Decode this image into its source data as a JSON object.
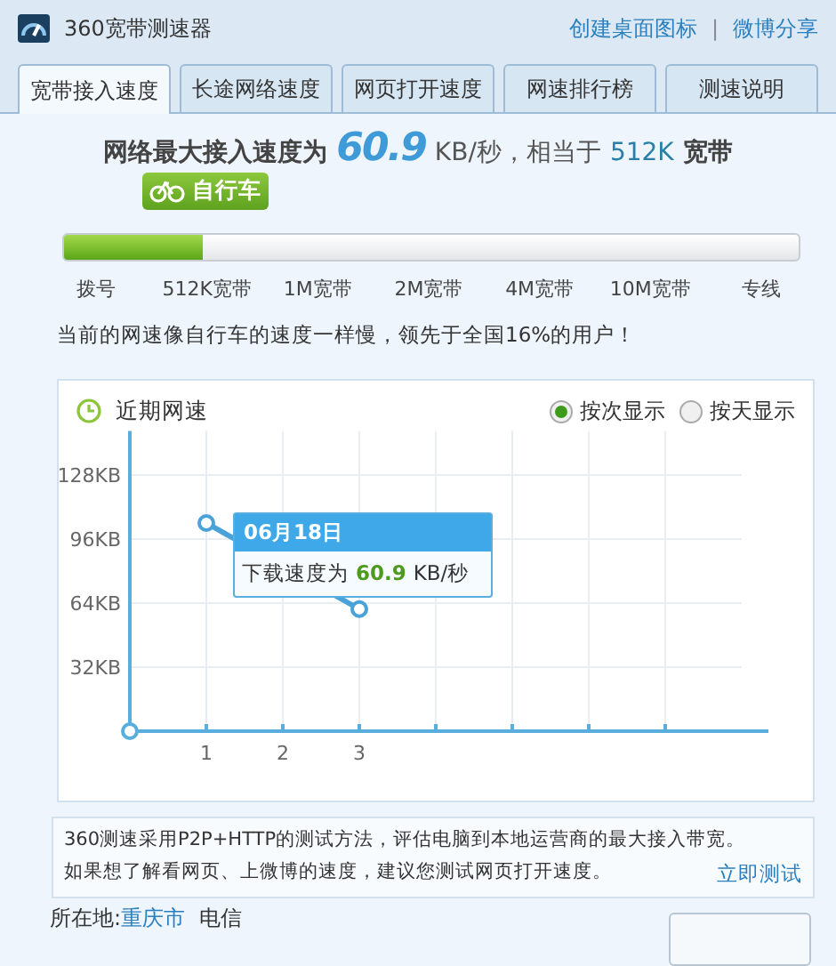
{
  "window": {
    "title": "360宽带测速器",
    "links": [
      "创建桌面图标",
      "微博分享"
    ],
    "separator": "|"
  },
  "tabs": [
    {
      "label": "宽带接入速度",
      "selected": true
    },
    {
      "label": "长途网络速度",
      "selected": false
    },
    {
      "label": "网页打开速度",
      "selected": false
    },
    {
      "label": "网速排行榜",
      "selected": false
    },
    {
      "label": "测速说明",
      "selected": false
    }
  ],
  "result": {
    "prefix": "网络最大接入速度为",
    "speed": "60.9",
    "unit": "KB/秒，相当于",
    "bandwidth": "512K",
    "suffix": "宽带"
  },
  "meter": {
    "badge": "自行车",
    "level": 0.19,
    "ticks": [
      "拨号",
      "512K宽带",
      "1M宽带",
      "2M宽带",
      "4M宽带",
      "10M宽带",
      "专线"
    ]
  },
  "comment": "当前的网速像自行车的速度一样慢，领先于全国16%的用户！",
  "recent": {
    "title": "近期网速",
    "options": [
      {
        "label": "按次显示",
        "selected": true
      },
      {
        "label": "按天显示",
        "selected": false
      }
    ],
    "chart_data": {
      "type": "line",
      "grid": true,
      "x": [
        1,
        3
      ],
      "series": [
        {
          "color": "#4aa3d8",
          "marker": "circle",
          "values": [
            104,
            61
          ]
        }
      ],
      "xlim": [
        0,
        8
      ],
      "ylim": [
        0,
        150
      ],
      "xticks": [
        1,
        2,
        3
      ],
      "yticks": [
        {
          "value": 32,
          "label": "32KB"
        },
        {
          "value": 64,
          "label": "64KB"
        },
        {
          "value": 96,
          "label": "96KB"
        },
        {
          "value": 128,
          "label": "128KB"
        }
      ]
    },
    "tooltip": {
      "date": "06月18日",
      "label": "下载速度为",
      "value": "60.9",
      "unit": "KB/秒"
    }
  },
  "info": {
    "lines": [
      "360测速采用P2P+HTTP的测试方法，评估电脑到本地运营商的最大接入带宽。",
      "如果想了解看网页、上微博的速度，建议您测试网页打开速度。"
    ],
    "link": "立即测试"
  },
  "location": {
    "label": "所在地:",
    "city": "重庆市",
    "isp": "电信"
  }
}
